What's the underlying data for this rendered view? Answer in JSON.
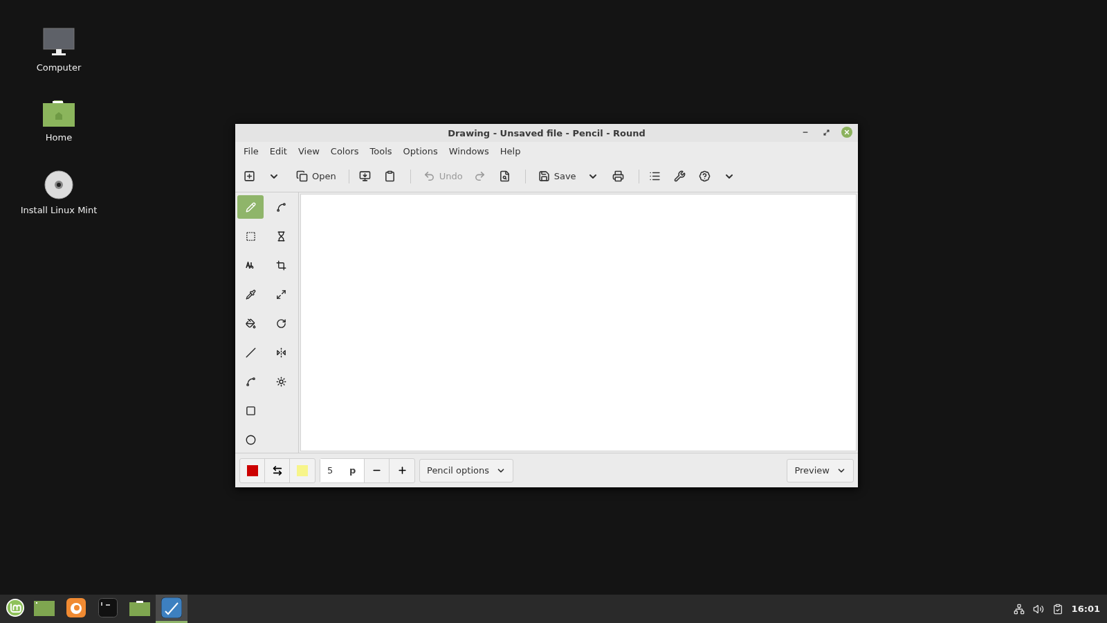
{
  "desktop_icons": [
    {
      "label": "Computer"
    },
    {
      "label": "Home"
    },
    {
      "label": "Install Linux Mint"
    }
  ],
  "window": {
    "title": "Drawing - Unsaved file - Pencil - Round"
  },
  "menu": [
    {
      "label": "File"
    },
    {
      "label": "Edit"
    },
    {
      "label": "View"
    },
    {
      "label": "Colors"
    },
    {
      "label": "Tools"
    },
    {
      "label": "Options"
    },
    {
      "label": "Windows"
    },
    {
      "label": "Help"
    }
  ],
  "toolbar": [
    {
      "kind": "icon",
      "disabled": false
    },
    {
      "kind": "caret",
      "disabled": false
    },
    {
      "kind": "labeled",
      "label": "Open",
      "disabled": false
    },
    {
      "kind": "sep"
    },
    {
      "kind": "icon",
      "disabled": false
    },
    {
      "kind": "icon",
      "disabled": false
    },
    {
      "kind": "sep"
    },
    {
      "kind": "labeled",
      "label": "Undo",
      "disabled": true
    },
    {
      "kind": "icon",
      "disabled": true
    },
    {
      "kind": "icon",
      "disabled": false
    },
    {
      "kind": "sep"
    },
    {
      "kind": "labeled",
      "label": "Save",
      "disabled": false
    },
    {
      "kind": "caret",
      "disabled": false
    },
    {
      "kind": "icon",
      "disabled": false
    },
    {
      "kind": "sep"
    },
    {
      "kind": "icon",
      "disabled": false
    },
    {
      "kind": "icon",
      "disabled": false
    },
    {
      "kind": "icon",
      "disabled": false
    },
    {
      "kind": "caret",
      "disabled": false
    }
  ],
  "tools": [
    {
      "selected": true
    },
    {
      "selected": false
    },
    {
      "selected": false
    },
    {
      "selected": false
    },
    {
      "selected": false
    },
    {
      "selected": false
    },
    {
      "selected": false
    },
    {
      "selected": false
    },
    {
      "selected": false
    },
    {
      "selected": false
    },
    {
      "selected": false
    },
    {
      "selected": false
    },
    {
      "selected": false
    },
    {
      "selected": false
    },
    {
      "selected": false
    },
    {
      "selected": false
    }
  ],
  "bottom_bar": {
    "main_color": {
      "color": "#cc0000"
    },
    "secondary_color": {
      "color": "#f7f58a"
    },
    "size": {
      "value": "5",
      "unit": "p"
    },
    "options_menu": {
      "label": "Pencil options"
    },
    "preview_menu": {
      "label": "Preview"
    }
  },
  "taskbar": {
    "apps": [
      {
        "selected": false
      },
      {
        "selected": false
      },
      {
        "selected": false
      },
      {
        "selected": false
      },
      {
        "selected": true
      }
    ],
    "clock": "16:01"
  }
}
